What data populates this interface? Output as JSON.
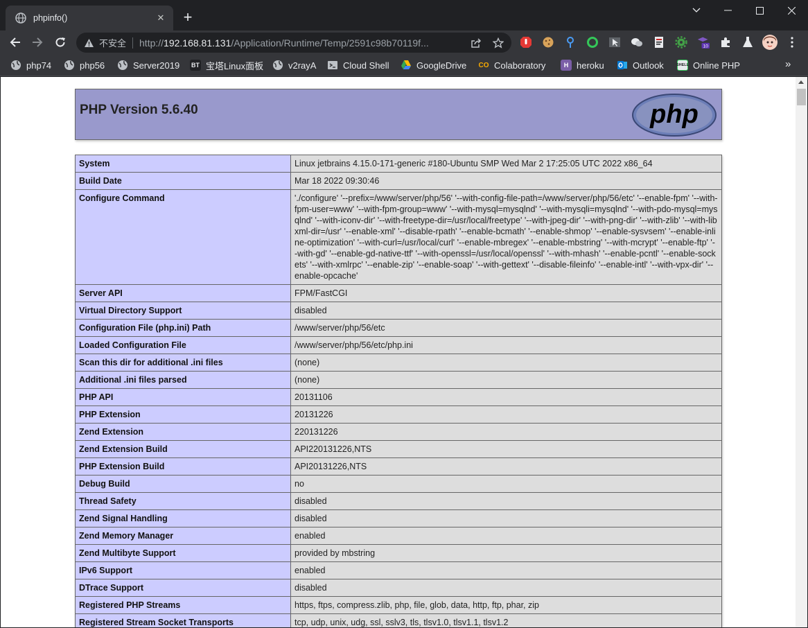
{
  "browser": {
    "tab": {
      "title": "phpinfo()"
    },
    "omnibox": {
      "security": "不安全",
      "url_scheme": "http://",
      "url_host": "192.168.81.131",
      "url_path": "/Application/Runtime/Temp/2591c98b70119f..."
    },
    "extensions": {
      "badge_count": "10"
    },
    "bookmarks": [
      {
        "label": "php74",
        "icon": "globe-icon"
      },
      {
        "label": "php56",
        "icon": "globe-icon"
      },
      {
        "label": "Server2019",
        "icon": "globe-icon"
      },
      {
        "label": "宝塔Linux面板",
        "icon": "bt-icon",
        "icon_text": "BT"
      },
      {
        "label": "v2rayA",
        "icon": "globe-icon"
      },
      {
        "label": "Cloud Shell",
        "icon": "terminal-icon"
      },
      {
        "label": "GoogleDrive",
        "icon": "drive-icon"
      },
      {
        "label": "Colaboratory",
        "icon": "colab-icon",
        "icon_text": "CO"
      },
      {
        "label": "heroku",
        "icon": "heroku-icon",
        "icon_text": "H"
      },
      {
        "label": "Outlook",
        "icon": "outlook-icon"
      },
      {
        "label": "Online PHP",
        "icon": "shell-icon",
        "icon_text": "SHELL"
      }
    ]
  },
  "page": {
    "header": {
      "title": "PHP Version 5.6.40",
      "logo_text": "php"
    },
    "rows": [
      {
        "key": "System",
        "value": "Linux jetbrains 4.15.0-171-generic #180-Ubuntu SMP Wed Mar 2 17:25:05 UTC 2022 x86_64"
      },
      {
        "key": "Build Date",
        "value": "Mar 18 2022 09:30:46"
      },
      {
        "key": "Configure Command",
        "value": "'./configure' '--prefix=/www/server/php/56' '--with-config-file-path=/www/server/php/56/etc' '--enable-fpm' '--with-fpm-user=www' '--with-fpm-group=www' '--with-mysql=mysqlnd' '--with-mysqli=mysqlnd' '--with-pdo-mysql=mysqlnd' '--with-iconv-dir' '--with-freetype-dir=/usr/local/freetype' '--with-jpeg-dir' '--with-png-dir' '--with-zlib' '--with-libxml-dir=/usr' '--enable-xml' '--disable-rpath' '--enable-bcmath' '--enable-shmop' '--enable-sysvsem' '--enable-inline-optimization' '--with-curl=/usr/local/curl' '--enable-mbregex' '--enable-mbstring' '--with-mcrypt' '--enable-ftp' '--with-gd' '--enable-gd-native-ttf' '--with-openssl=/usr/local/openssl' '--with-mhash' '--enable-pcntl' '--enable-sockets' '--with-xmlrpc' '--enable-zip' '--enable-soap' '--with-gettext' '--disable-fileinfo' '--enable-intl' '--with-vpx-dir' '--enable-opcache'"
      },
      {
        "key": "Server API",
        "value": "FPM/FastCGI"
      },
      {
        "key": "Virtual Directory Support",
        "value": "disabled"
      },
      {
        "key": "Configuration File (php.ini) Path",
        "value": "/www/server/php/56/etc"
      },
      {
        "key": "Loaded Configuration File",
        "value": "/www/server/php/56/etc/php.ini"
      },
      {
        "key": "Scan this dir for additional .ini files",
        "value": "(none)"
      },
      {
        "key": "Additional .ini files parsed",
        "value": "(none)"
      },
      {
        "key": "PHP API",
        "value": "20131106"
      },
      {
        "key": "PHP Extension",
        "value": "20131226"
      },
      {
        "key": "Zend Extension",
        "value": "220131226"
      },
      {
        "key": "Zend Extension Build",
        "value": "API220131226,NTS"
      },
      {
        "key": "PHP Extension Build",
        "value": "API20131226,NTS"
      },
      {
        "key": "Debug Build",
        "value": "no"
      },
      {
        "key": "Thread Safety",
        "value": "disabled"
      },
      {
        "key": "Zend Signal Handling",
        "value": "disabled"
      },
      {
        "key": "Zend Memory Manager",
        "value": "enabled"
      },
      {
        "key": "Zend Multibyte Support",
        "value": "provided by mbstring"
      },
      {
        "key": "IPv6 Support",
        "value": "enabled"
      },
      {
        "key": "DTrace Support",
        "value": "disabled"
      },
      {
        "key": "Registered PHP Streams",
        "value": "https, ftps, compress.zlib, php, file, glob, data, http, ftp, phar, zip"
      },
      {
        "key": "Registered Stream Socket Transports",
        "value": "tcp, udp, unix, udg, ssl, sslv3, tls, tlsv1.0, tlsv1.1, tlsv1.2"
      }
    ]
  },
  "colors": {
    "header_bg": "#9999cc",
    "key_bg": "#ccccff",
    "value_bg": "#dddddd",
    "chrome_dark": "#202124",
    "chrome_toolbar": "#35363a"
  }
}
